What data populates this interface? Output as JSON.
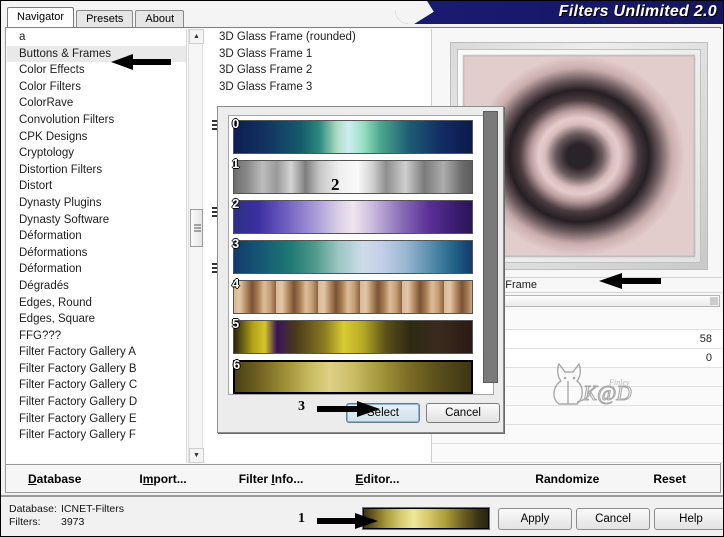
{
  "window": {
    "title": "Filters Unlimited 2.0"
  },
  "tabs": [
    {
      "label": "Navigator",
      "active": true
    },
    {
      "label": "Presets",
      "active": false
    },
    {
      "label": "About",
      "active": false
    }
  ],
  "categories": [
    "a",
    "Buttons & Frames",
    "Color Effects",
    "Color Filters",
    "ColorRave",
    "Convolution Filters",
    "CPK Designs",
    "Cryptology",
    "Distortion Filters",
    "Distort",
    "Dynasty Plugins",
    "Dynasty Software",
    "Déformation",
    "Déformations",
    "Déformation",
    "Dégradés",
    "Edges, Round",
    "Edges, Square",
    "FFG???",
    "Filter Factory Gallery A",
    "Filter Factory Gallery B",
    "Filter Factory Gallery C",
    "Filter Factory Gallery D",
    "Filter Factory Gallery E",
    "Filter Factory Gallery F"
  ],
  "selected_category": "Buttons & Frames",
  "filters": [
    "3D Glass Frame (rounded)",
    "3D Glass Frame 1",
    "3D Glass Frame 2",
    "3D Glass Frame 3"
  ],
  "preview": {
    "effect_label": "Gradient Frame",
    "params": [
      {
        "value": "58"
      },
      {
        "value": "0"
      }
    ],
    "logo_text": "K@D",
    "logo_sub": "Finley"
  },
  "menu": [
    {
      "label": "Database",
      "accel": "D"
    },
    {
      "label": "Import...",
      "accel": "m"
    },
    {
      "label": "Filter Info...",
      "accel": "I"
    },
    {
      "label": "Editor...",
      "accel": "E"
    },
    {
      "label": "Randomize",
      "accel": ""
    },
    {
      "label": "Reset",
      "accel": ""
    }
  ],
  "status": {
    "database_key": "Database:",
    "database_value": "ICNET-Filters",
    "filters_key": "Filters:",
    "filters_value": "3973"
  },
  "action_buttons": [
    {
      "id": "apply",
      "label": "Apply"
    },
    {
      "id": "cancel",
      "label": "Cancel"
    },
    {
      "id": "help",
      "label": "Help"
    }
  ],
  "gradient_dialog": {
    "select_label": "Select",
    "cancel_label": "Cancel",
    "selected_index": 6,
    "rows": [
      {
        "num": "0",
        "css": "linear-gradient(90deg,#0d1f52 0%,#12305f 12%,#155a6b 28%,#2d8a7d 36%,#a9d8c0 43%,#cdeef0 48%,#9ce0c8 54%,#4aa58c 62%,#1d5a74 74%,#112a63 88%,#0b1a4c 100%)"
      },
      {
        "num": "1",
        "css": "linear-gradient(90deg,#6e6e6e 0%,#8c8c8c 6%,#bdbdbd 12%,#9a9a9a 18%,#d4d4d4 24%,#7e7e7e 30%,#c6c6c6 36%,#efefef 44%,#fafafa 52%,#d2d2d2 58%,#8e8e8e 64%,#cfcfcf 72%,#7a7a7a 80%,#adadad 88%,#6a6a6a 96%,#5e5e5e 100%)"
      },
      {
        "num": "2",
        "css": "linear-gradient(90deg,#2f2f86 0%,#3b2fa0 10%,#6f5fc0 22%,#a79ad6 34%,#d8cfe6 44%,#efe6ee 50%,#cbbcdd 58%,#8a6fb8 70%,#5a2f96 82%,#3d1e73 92%,#2a1456 100%)"
      },
      {
        "num": "3",
        "css": "linear-gradient(90deg,#123a6e 0%,#165a74 12%,#1f7a74 24%,#4f9a8a 34%,#9dc6c4 44%,#ccdde8 54%,#c4cfe8 62%,#9ab7d2 72%,#4f88a8 84%,#1c5a82 94%,#123a6e 100%)"
      },
      {
        "num": "4",
        "css": "repeating-linear-gradient(90deg,#d8b895 0px,#e2c7a6 6px,#b28a63 12px,#7a5334 18px,#a87d55 24px,#ddbd98 30px,#c49f78 36px,#8b6240 42px)"
      },
      {
        "num": "5",
        "css": "linear-gradient(90deg,#2a2410 0%,#b3a317 8%,#d6c62a 13%,#3a1458 18%,#4a3a18 26%,#8a7a22 38%,#d8cc2f 46%,#b8ab28 54%,#5a5018 64%,#2e2a12 74%,#3a2a1e 86%,#2a1a14 100%)"
      },
      {
        "num": "6",
        "css": "linear-gradient(90deg,#4a4016 0%,#6f6220 10%,#a2923a 22%,#c9bb62 32%,#ddd086 40%,#cbbd66 50%,#a2943a 62%,#7a6c24 74%,#5a4f1a 86%,#3e3614 100%)"
      }
    ]
  },
  "annotations": [
    {
      "id": "1",
      "label": "1"
    },
    {
      "id": "2",
      "label": "2"
    },
    {
      "id": "3",
      "label": "3"
    }
  ]
}
